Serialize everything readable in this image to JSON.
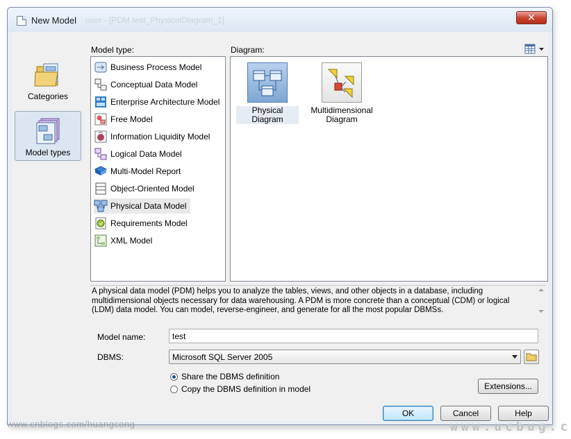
{
  "window": {
    "title": "New Model",
    "title_ghost": "user - [PDM test_PhysicalDiagram_1]",
    "close_glyph": "✕"
  },
  "nav": [
    {
      "label": "Categories",
      "icon": "categories-icon",
      "selected": false
    },
    {
      "label": "Model types",
      "icon": "model-types-icon",
      "selected": true
    }
  ],
  "model_type": {
    "label": "Model type:",
    "items": [
      {
        "label": "Business Process Model",
        "icon": "business-process-icon"
      },
      {
        "label": "Conceptual Data Model",
        "icon": "conceptual-data-icon"
      },
      {
        "label": "Enterprise Architecture Model",
        "icon": "enterprise-architecture-icon"
      },
      {
        "label": "Free Model",
        "icon": "free-model-icon"
      },
      {
        "label": "Information Liquidity Model",
        "icon": "information-liquidity-icon"
      },
      {
        "label": "Logical Data Model",
        "icon": "logical-data-icon"
      },
      {
        "label": "Multi-Model Report",
        "icon": "multi-model-report-icon"
      },
      {
        "label": "Object-Oriented Model",
        "icon": "object-oriented-icon"
      },
      {
        "label": "Physical Data Model",
        "icon": "physical-data-icon",
        "selected": true
      },
      {
        "label": "Requirements Model",
        "icon": "requirements-icon"
      },
      {
        "label": "XML Model",
        "icon": "xml-model-icon"
      }
    ]
  },
  "diagram": {
    "label": "Diagram:",
    "items": [
      {
        "label": "Physical Diagram",
        "icon": "physical-diagram-icon",
        "selected": true
      },
      {
        "label": "Multidimensional\nDiagram",
        "icon": "multidimensional-diagram-icon"
      }
    ]
  },
  "description": "A physical data model (PDM) helps you to analyze the tables, views, and other objects in a database, including multidimensional objects necessary for data warehousing. A PDM is more concrete than a conceptual (CDM) or logical (LDM) data model. You can model, reverse-engineer, and generate for all the most popular DBMSs.",
  "form": {
    "model_name_label": "Model name:",
    "model_name_value": "test",
    "dbms_label": "DBMS:",
    "dbms_value": "Microsoft SQL Server 2005",
    "radio_share": "Share the DBMS definition",
    "radio_copy": "Copy the DBMS definition in model",
    "share_selected": true,
    "extensions_label": "Extensions..."
  },
  "buttons": {
    "ok": "OK",
    "cancel": "Cancel",
    "help": "Help"
  },
  "watermarks": {
    "left": "www.cnblogs.com/huangcong",
    "right": "www.ucbug.cc"
  }
}
